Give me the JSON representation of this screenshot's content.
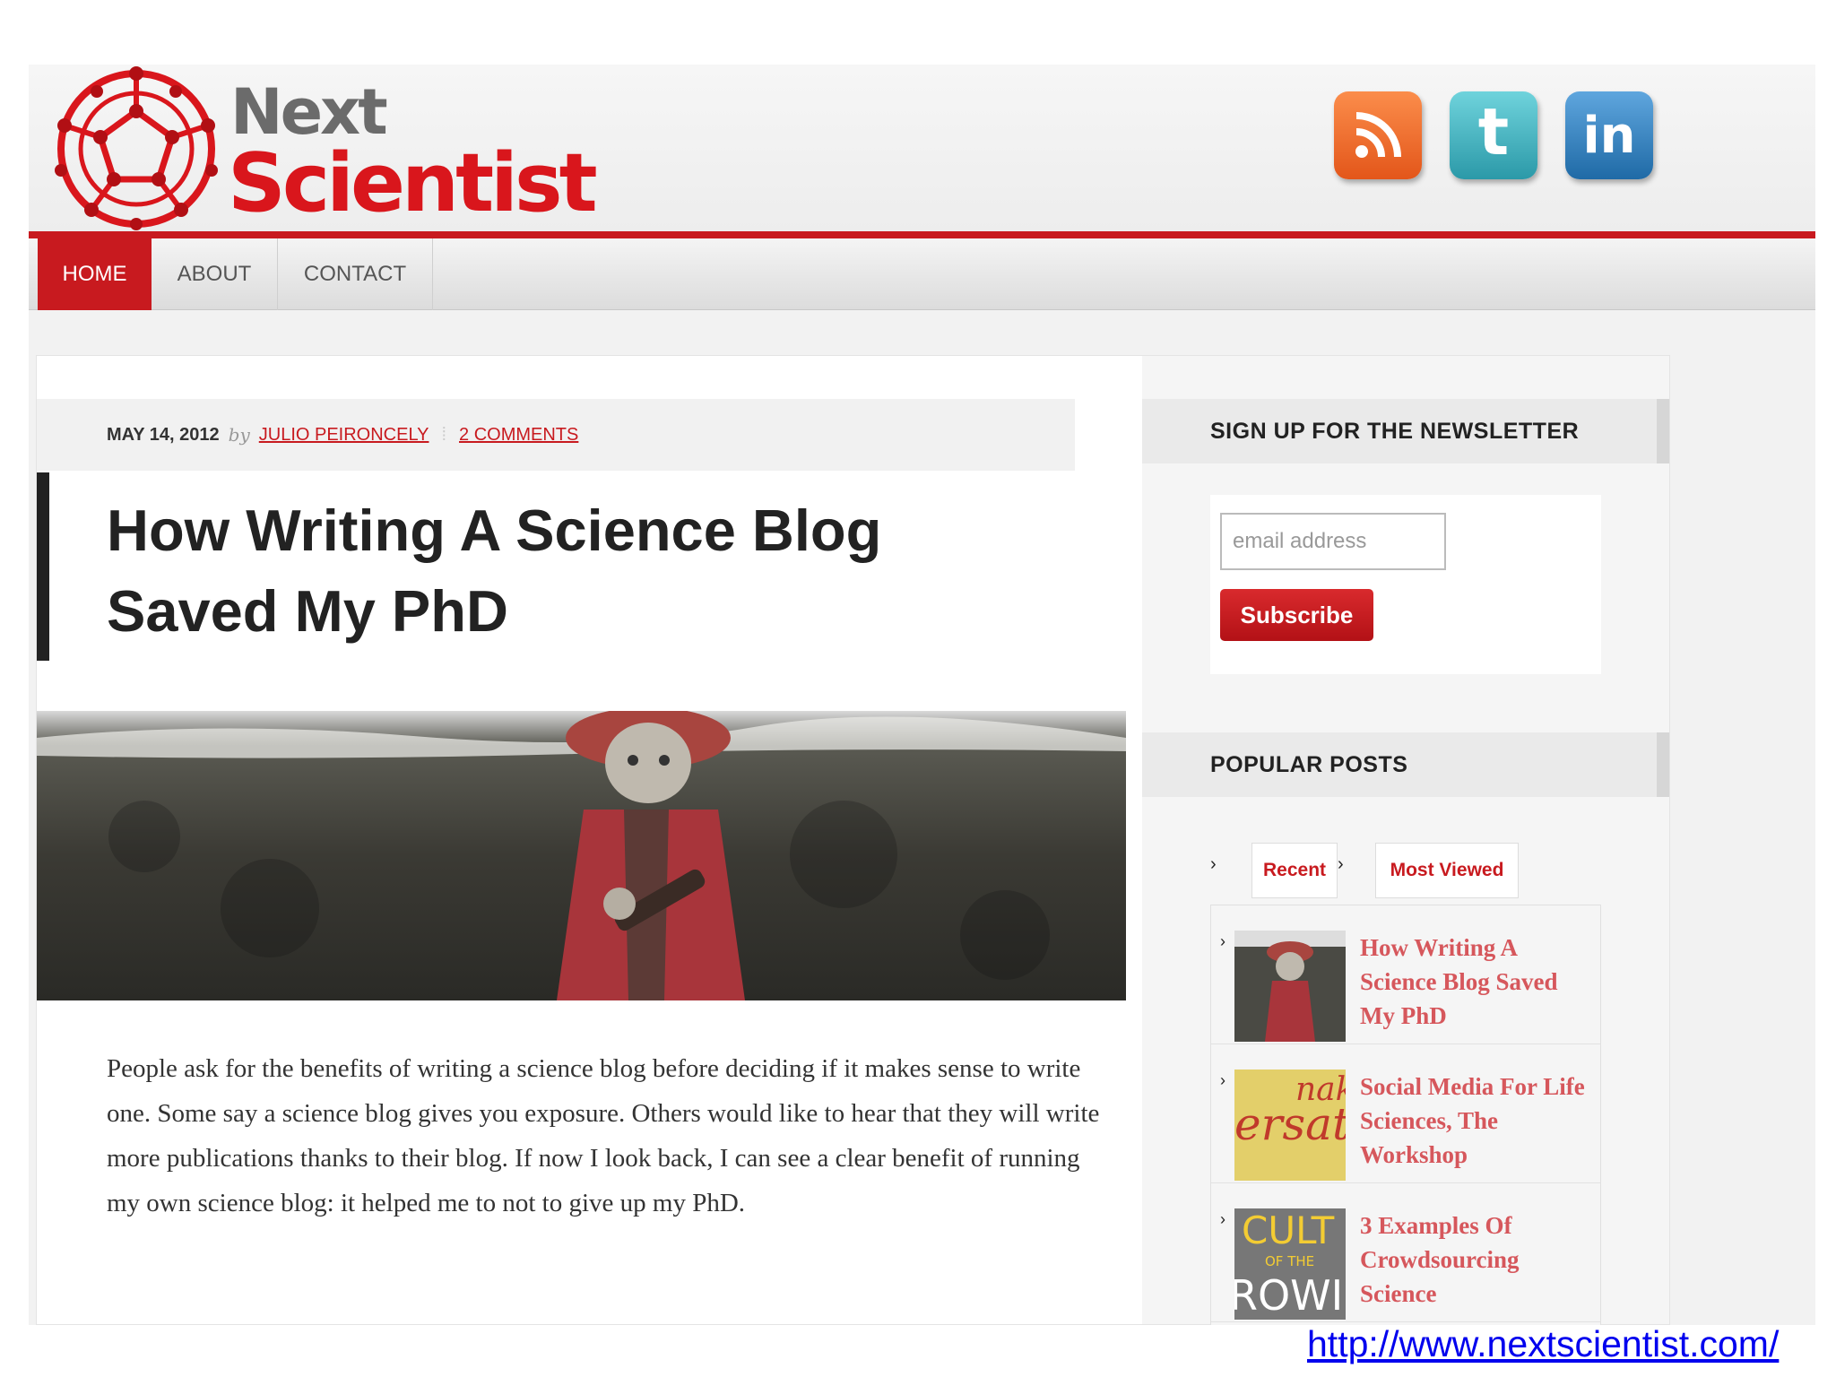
{
  "logo": {
    "line1": "Next",
    "line2": "Scientist"
  },
  "social": {
    "rss": "rss-icon",
    "twitter": "twitter-icon",
    "linkedin": "linkedin-icon",
    "twitter_glyph": "t",
    "linkedin_glyph": "in"
  },
  "nav": {
    "items": [
      {
        "label": "HOME"
      },
      {
        "label": "ABOUT"
      },
      {
        "label": "CONTACT"
      }
    ]
  },
  "post": {
    "date": "MAY 14, 2012",
    "by": "by",
    "author": "JULIO PEIRONCELY",
    "comments": "2 COMMENTS",
    "title": "How Writing A Science Blog Saved My PhD",
    "body": "People ask for the benefits of writing a science blog before deciding if it makes sense to write one. Some say a science blog gives you exposure. Others would like to hear that they will write more publications thanks to their blog. If now I look back, I can see a clear benefit of running my own science blog: it helped me to not to give up my PhD."
  },
  "newsletter": {
    "heading": "SIGN UP FOR THE NEWSLETTER",
    "email_placeholder": "email address",
    "button": "Subscribe"
  },
  "popular": {
    "heading": "POPULAR POSTS",
    "tabs": [
      {
        "label": "Recent"
      },
      {
        "label": "Most Viewed"
      }
    ],
    "posts": [
      {
        "title": "How Writing A Science Blog Saved My PhD"
      },
      {
        "title": "Social Media For Life Sciences, The Workshop",
        "thumb_text1": "nak",
        "thumb_text2": "ersati"
      },
      {
        "title": "3 Examples Of Crowdsourcing Science",
        "thumb_text1": "CULT",
        "thumb_text2": "OF THE",
        "thumb_text3": "ROWI"
      }
    ]
  },
  "footer": {
    "url": "http://www.nextscientist.com/"
  },
  "colors": {
    "brand_red": "#c81a1f",
    "link_red": "#d6575c",
    "rss_orange": "#e3561a",
    "twitter_teal": "#2b99a8",
    "linkedin_blue": "#1f6aa6"
  }
}
